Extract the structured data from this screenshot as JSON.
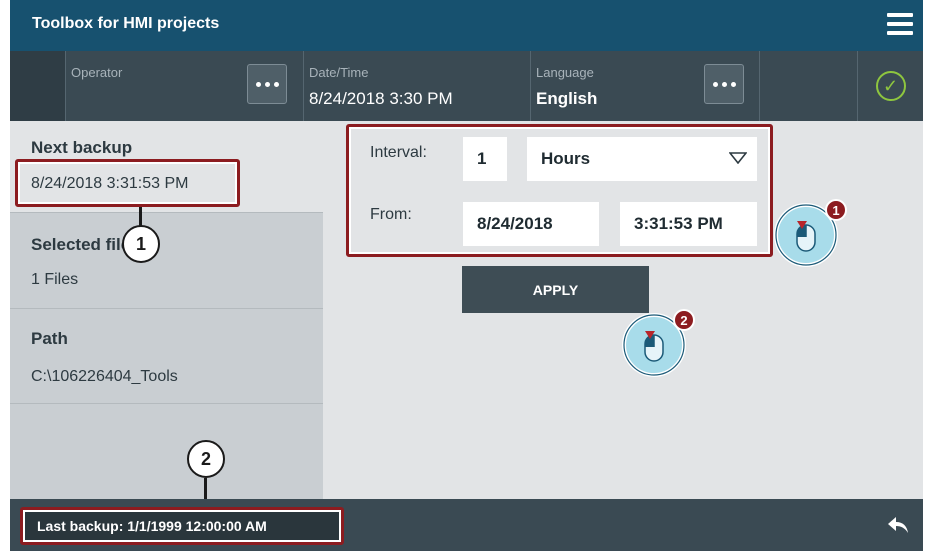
{
  "header": {
    "title": "Toolbox for HMI projects"
  },
  "statusbar": {
    "operator_label": "Operator",
    "datetime_label": "Date/Time",
    "datetime_value": "8/24/2018 3:30 PM",
    "language_label": "Language",
    "language_value": "English"
  },
  "left": {
    "next_backup_label": "Next backup",
    "next_backup_value": "8/24/2018 3:31:53 PM",
    "selected_files_label": "Selected files",
    "selected_files_value": "1 Files",
    "path_label": "Path",
    "path_value": "C:\\106226404_Tools"
  },
  "form": {
    "interval_label": "Interval:",
    "interval_value": "1",
    "interval_unit": "Hours",
    "from_label": "From:",
    "from_date": "8/24/2018",
    "from_time": "3:31:53 PM",
    "apply_label": "APPLY"
  },
  "footer": {
    "last_backup": "Last backup: 1/1/1999 12:00:00 AM"
  },
  "callouts": {
    "one": "1",
    "two": "2"
  },
  "icons": [
    "hamburger-icon",
    "dots-icon",
    "check-circle-icon",
    "back-arrow-icon",
    "dropdown-triangle-icon",
    "mouse-pointer-icon"
  ],
  "colors": {
    "header": "#17516f",
    "accent_check": "#8ec63f",
    "highlight": "#8c1c20"
  }
}
